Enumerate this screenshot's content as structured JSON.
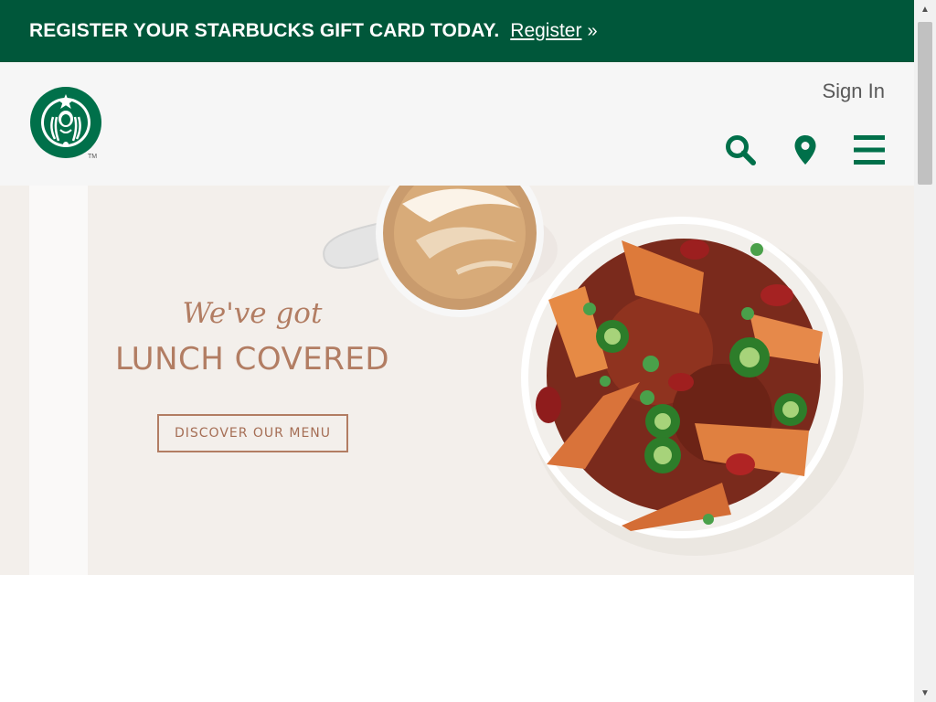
{
  "promo": {
    "text": "REGISTER YOUR STARBUCKS GIFT CARD TODAY.",
    "link_label": "Register",
    "arrow": "»",
    "bg_color": "#00573a"
  },
  "header": {
    "logo_icon": "starbucks-siren-logo",
    "trademark": "TM",
    "signin_label": "Sign In",
    "icons": [
      "search-icon",
      "location-pin-icon",
      "hamburger-menu-icon"
    ],
    "icon_color": "#00704a"
  },
  "hero": {
    "kicker": "We've got",
    "title": "LUNCH COVERED",
    "cta_label": "DISCOVER OUR MENU",
    "text_color": "#b27d63",
    "image_icons": [
      "latte-cup",
      "chili-bowl"
    ]
  },
  "scrollbar": {
    "up": "▲",
    "down": "▼"
  }
}
